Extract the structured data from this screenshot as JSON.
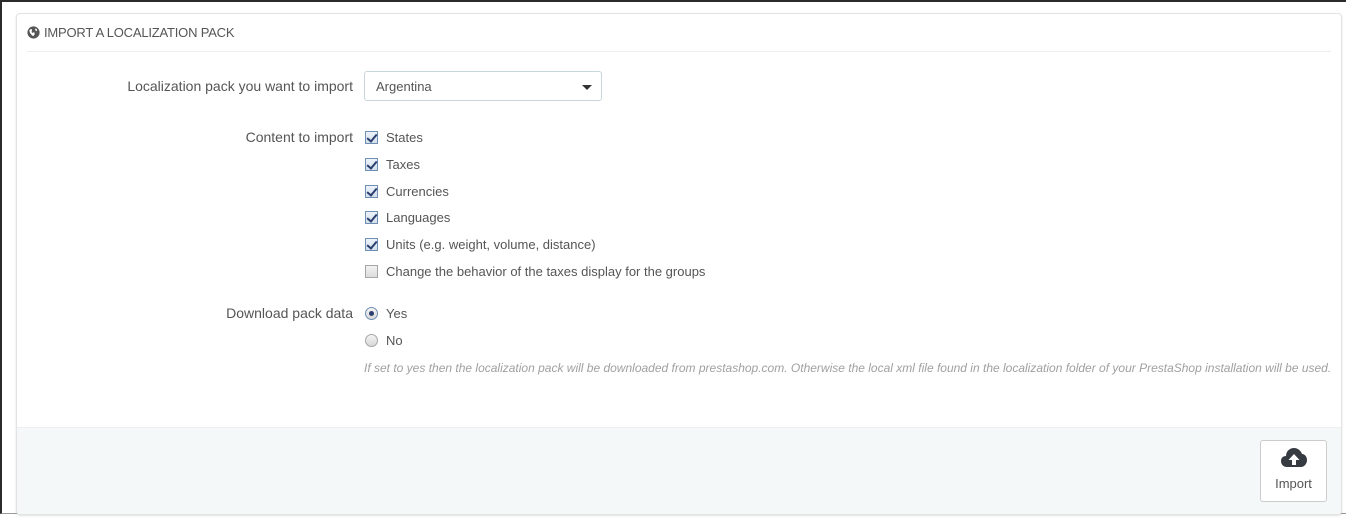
{
  "panel": {
    "title": "IMPORT A LOCALIZATION PACK",
    "title_icon": "globe-icon"
  },
  "pack": {
    "label": "Localization pack you want to import",
    "selected": "Argentina"
  },
  "content": {
    "label": "Content to import",
    "options": [
      {
        "label": "States",
        "checked": true
      },
      {
        "label": "Taxes",
        "checked": true
      },
      {
        "label": "Currencies",
        "checked": true
      },
      {
        "label": "Languages",
        "checked": true
      },
      {
        "label": "Units (e.g. weight, volume, distance)",
        "checked": true
      },
      {
        "label": "Change the behavior of the taxes display for the groups",
        "checked": false
      }
    ]
  },
  "download": {
    "label": "Download pack data",
    "options": [
      {
        "label": "Yes",
        "selected": true
      },
      {
        "label": "No",
        "selected": false
      }
    ],
    "help": "If set to yes then the localization pack will be downloaded from prestashop.com. Otherwise the local xml file found in the localization folder of your PrestaShop installation will be used."
  },
  "footer": {
    "import_label": "Import",
    "import_icon": "cloud-upload-icon"
  },
  "colors": {
    "panel_border": "#e3e3e3",
    "footer_bg": "#f5f8f9",
    "text": "#555555",
    "help_text": "#a0a0a0"
  }
}
